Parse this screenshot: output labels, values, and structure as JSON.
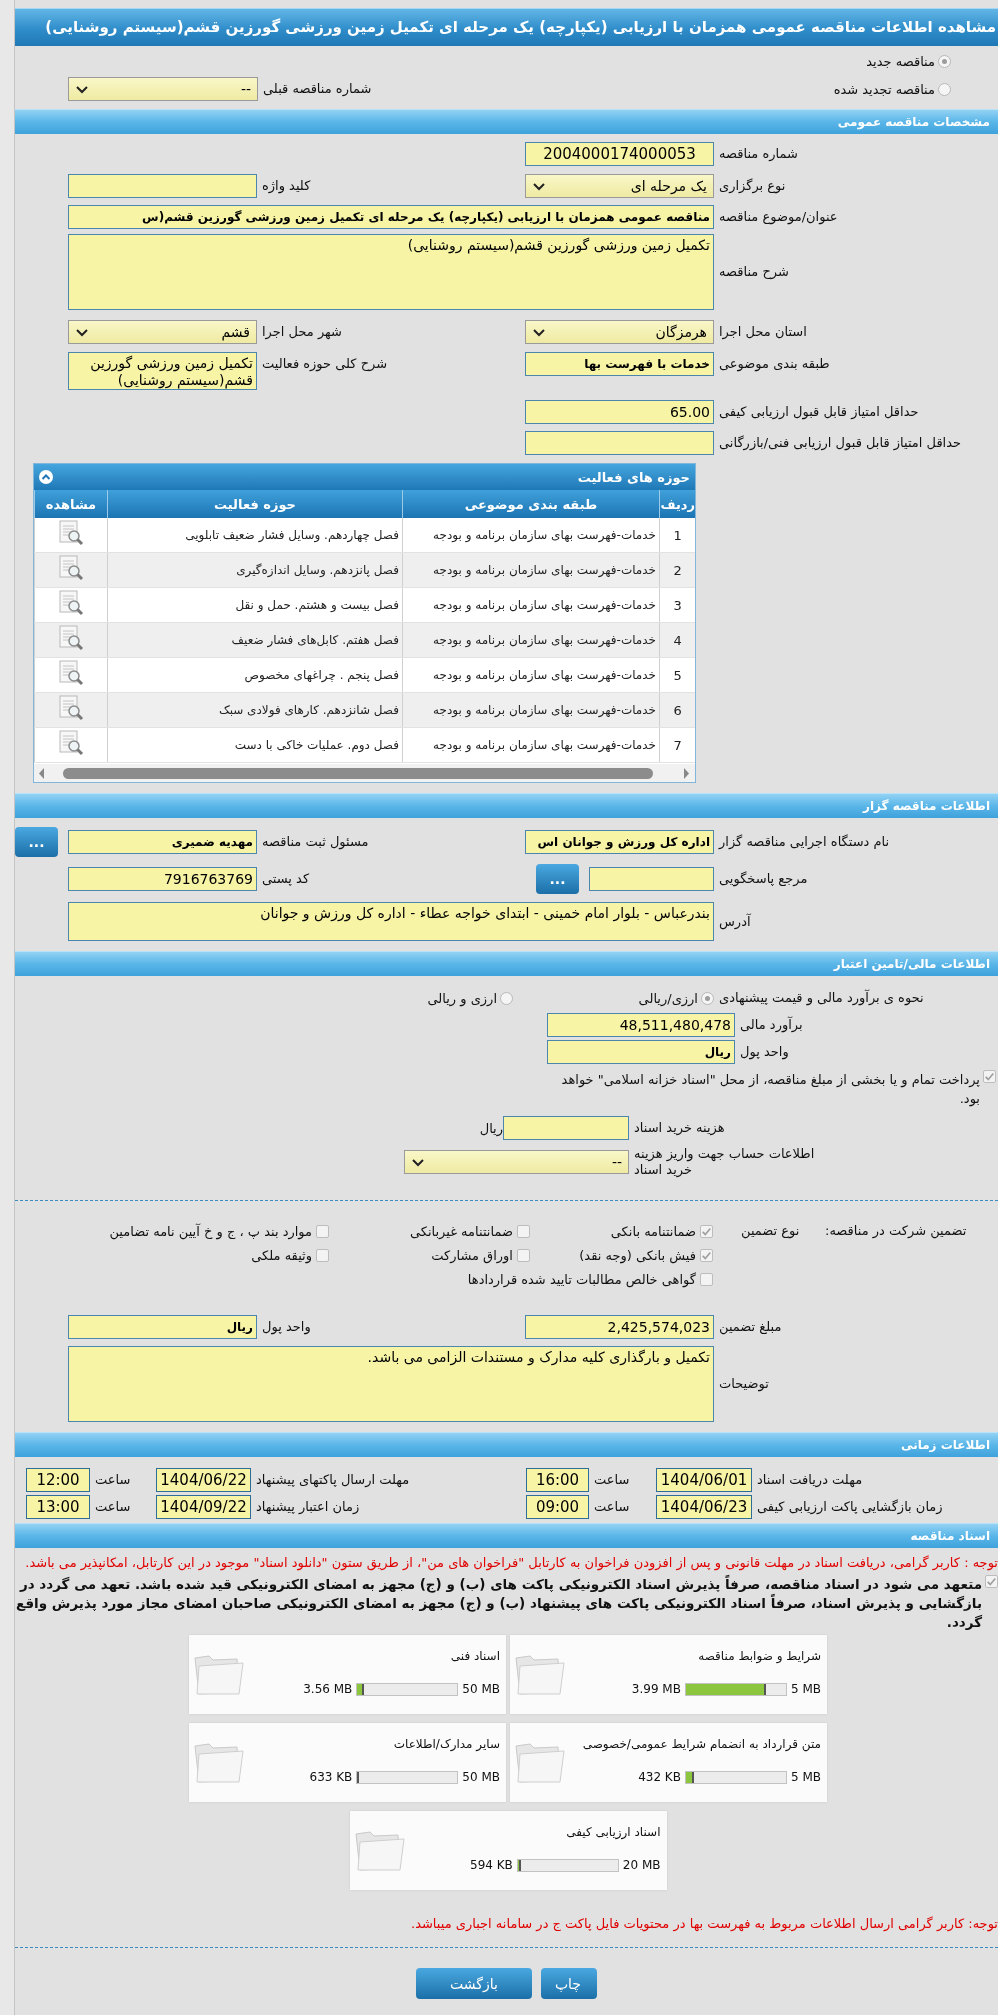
{
  "title": "مشاهده اطلاعات مناقصه عمومی همزمان با ارزیابی (یکپارچه) یک مرحله ای تکمیل زمین ورزشی گورزین قشم(سیستم روشنایی)",
  "tender_kind": [
    {
      "label": "مناقصه جدید",
      "selected": true
    },
    {
      "label": "مناقصه تجدید شده",
      "selected": false
    }
  ],
  "previous_tender": {
    "label": "شماره مناقصه قبلی",
    "value": "--",
    "kind": "select"
  },
  "general": {
    "header": "مشخصات مناقصه عمومی",
    "rows": [
      {
        "kind": "pair",
        "right": {
          "label": "شماره مناقصه",
          "value": "2004000174000053",
          "kind": "code"
        }
      },
      {
        "kind": "pair",
        "right": {
          "label": "نوع برگزاری",
          "value": "یک مرحله ای",
          "kind": "select"
        },
        "left": {
          "label": "کلید واژه",
          "kind": "text"
        }
      },
      {
        "kind": "wide",
        "right": {
          "label": "عنوان/موضوع مناقصه",
          "value": "مناقصه عمومی همزمان با ارزیابی (یکپارچه) یک مرحله ای تکمیل زمین ورزشی گورزین قشم(س",
          "kind": "bold"
        }
      },
      {
        "kind": "wide",
        "right": {
          "label": "شرح مناقصه",
          "value": "تکمیل زمین ورزشی گورزین قشم(سیستم روشنایی)",
          "kind": "textarea"
        }
      },
      {
        "kind": "pair",
        "right": {
          "label": "استان محل اجرا",
          "value": "هرمزگان",
          "kind": "select"
        },
        "left": {
          "label": "شهر محل اجرا",
          "value": "قشم",
          "kind": "select"
        }
      },
      {
        "kind": "pair",
        "right": {
          "label": "طبقه بندی موضوعی",
          "value": "خدمات با فهرست بها",
          "kind": "bold"
        },
        "left": {
          "label": "شرح کلی حوزه فعالیت",
          "value": "تکمیل زمین ورزشی گورزین قشم(سیستم روشنایی)",
          "kind": "textarea"
        }
      },
      {
        "kind": "pair",
        "right": {
          "label": "حداقل امتیاز قابل قبول ارزیابی کیفی",
          "value": "65.00",
          "kind": "text"
        }
      },
      {
        "kind": "pair",
        "right": {
          "label": "حداقل امتیاز قابل قبول ارزیابی فنی/بازرگانی",
          "kind": "text"
        }
      }
    ]
  },
  "activities": {
    "header": "حوزه های فعالیت",
    "columns": [
      "ردیف",
      "طبقه بندی موضوعی",
      "حوزه فعالیت",
      "مشاهده"
    ],
    "rows": [
      {
        "row_number": "1",
        "category": "خدمات-فهرست بهای سازمان برنامه و بودجه",
        "activity": "فصل چهاردهم. وسایل فشار ضعیف تابلویی"
      },
      {
        "row_number": "2",
        "category": "خدمات-فهرست بهای سازمان برنامه و بودجه",
        "activity": "فصل پانزدهم. وسایل اندازه‌گیری"
      },
      {
        "row_number": "3",
        "category": "خدمات-فهرست بهای سازمان برنامه و بودجه",
        "activity": "فصل بیست و هشتم. حمل و نقل"
      },
      {
        "row_number": "4",
        "category": "خدمات-فهرست بهای سازمان برنامه و بودجه",
        "activity": "فصل هفتم. کابل‌های فشار ضعیف"
      },
      {
        "row_number": "5",
        "category": "خدمات-فهرست بهای سازمان برنامه و بودجه",
        "activity": "فصل پنجم . چراغهای مخصوص"
      },
      {
        "row_number": "6",
        "category": "خدمات-فهرست بهای سازمان برنامه و بودجه",
        "activity": "فصل شانزدهم. کارهای فولادی سبک"
      },
      {
        "row_number": "7",
        "category": "خدمات-فهرست بهای سازمان برنامه و بودجه",
        "activity": "فصل دوم. عملیات خاکی با دست"
      }
    ]
  },
  "organizer": {
    "header": "اطلاعات مناقصه گزار",
    "rows": [
      {
        "kind": "pair",
        "right": {
          "label": "نام دستگاه اجرایی مناقصه گزار",
          "value": "اداره کل ورزش و جوانان اس",
          "kind": "bold"
        },
        "left": {
          "label": "مسئول ثبت مناقصه",
          "value": "مهدیه ضمیری",
          "kind": "bold",
          "button": "..."
        }
      },
      {
        "kind": "pair",
        "right": {
          "label": "مرجع پاسخگویی",
          "kind": "text",
          "button": "..."
        },
        "left": {
          "label": "کد پستی",
          "value": "7916763769",
          "kind": "text"
        }
      },
      {
        "kind": "wide",
        "right": {
          "label": "آدرس",
          "value": "بندرعباس - بلوار امام خمینی - ابتدای خواجه عطاء - اداره کل ورزش و جوانان",
          "kind": "textarea"
        }
      }
    ]
  },
  "finance": {
    "header": "اطلاعات مالی/تامین اعتبار",
    "estimate_method": {
      "label": "نحوه ی برآورد مالی و قیمت پیشنهادی",
      "options": [
        {
          "label": "ارزی/ریالی",
          "selected": true
        },
        {
          "label": "ارزی و ریالی",
          "selected": false
        }
      ]
    },
    "estimate": {
      "label": "برآورد مالی",
      "value": "48,511,480,478"
    },
    "currency": {
      "label": "واحد پول",
      "value": "ریال"
    },
    "treasury": {
      "text": "پرداخت تمام و یا بخشی از مبلغ مناقصه، از محل \"اسناد خزانه اسلامی\" خواهد بود.",
      "checked": true
    },
    "document_fee": {
      "label": "هزینه خرید اسناد",
      "unit": "ریال"
    },
    "account": {
      "label": "اطلاعات حساب جهت واریز هزینه خرید اسناد",
      "value": "--"
    }
  },
  "guarantee": {
    "label": "تضمین شرکت در مناقصه:",
    "type_label": "نوع تضمین",
    "options": [
      {
        "label": "ضمانتنامه بانکی",
        "checked": true
      },
      {
        "label": "ضمانتنامه غیربانکی",
        "checked": false
      },
      {
        "label": "موارد بند پ ، ج و خ آیین نامه تضامین",
        "checked": false
      },
      {
        "label": "فیش بانکی (وجه نقد)",
        "checked": true
      },
      {
        "label": "اوراق مشارکت",
        "checked": false
      },
      {
        "label": "وثیقه ملکی",
        "checked": false
      },
      {
        "label": "گواهی خالص مطالبات تایید شده قراردادها",
        "checked": false
      }
    ],
    "rows": [
      {
        "kind": "pair",
        "right": {
          "label": "مبلغ تضمین",
          "value": "2,425,574,023",
          "kind": "text"
        },
        "left": {
          "label": "واحد پول",
          "value": "ریال",
          "kind": "bold"
        }
      },
      {
        "kind": "wide",
        "right": {
          "label": "توضیحات",
          "value": "تکمیل و بارگذاری کلیه مدارک و مستندات الزامی می باشد.",
          "kind": "textarea"
        }
      }
    ]
  },
  "timing": {
    "header": "اطلاعات زمانی",
    "items": [
      {
        "label": "مهلت دریافت اسناد",
        "date": "1404/06/01",
        "time_label": "ساعت",
        "time": "16:00"
      },
      {
        "label": "مهلت ارسال پاکتهای پیشنهاد",
        "date": "1404/06/22",
        "time_label": "ساعت",
        "time": "12:00"
      },
      {
        "label": "زمان بازگشایی پاکت ارزیابی کیفی",
        "date": "1404/06/23",
        "time_label": "ساعت",
        "time": "09:00"
      },
      {
        "label": "زمان اعتبار پیشنهاد",
        "date": "1404/09/22",
        "time_label": "ساعت",
        "time": "13:00"
      }
    ]
  },
  "documents": {
    "header": "اسناد مناقصه",
    "note": "توجه : کاربر گرامی، دریافت اسناد در مهلت قانونی و پس از افزودن فراخوان به کارتابل \"فراخوان های من\"، از طریق ستون \"دانلود اسناد\" موجود در این کارتابل، امکانپذیر می باشد.",
    "commitment": {
      "text": "متعهد می شود در اسناد مناقصه، صرفاً پذیرش اسناد الکترونیکی پاکت های (ب) و (ج) مجهز به امضای الکترونیکی قید شده باشد. تعهد می گردد در بازگشایی و پذیرش اسناد، صرفاً اسناد الکترونیکی پاکت های پیشنهاد (ب) و (ج) مجهز به امضای الکترونیکی صاحبان امضای مجاز مورد پذیرش واقع گردد.",
      "checked": true
    },
    "files": [
      {
        "title": "شرایط و ضوابط مناقصه",
        "size": "3.99 MB",
        "max": "5 MB",
        "level": 0.8
      },
      {
        "title": "اسناد فنی",
        "size": "3.56 MB",
        "max": "50 MB",
        "level": 0.07
      },
      {
        "title": "متن قرارداد به انضمام شرایط عمومی/خصوصی",
        "size": "432 KB",
        "max": "5 MB",
        "level": 0.084
      },
      {
        "title": "سایر مدارک/اطلاعات",
        "size": "633 KB",
        "max": "50 MB",
        "level": 0.013
      },
      {
        "title": "اسناد ارزیابی کیفی",
        "size": "594 KB",
        "max": "20 MB",
        "level": 0.03
      }
    ],
    "footer_note": "توجه: کاربر گرامی ارسال اطلاعات مربوط به فهرست بها در محتویات فایل پاکت ج در سامانه اجباری میباشد."
  },
  "buttons": [
    "چاپ",
    "بازگشت"
  ]
}
